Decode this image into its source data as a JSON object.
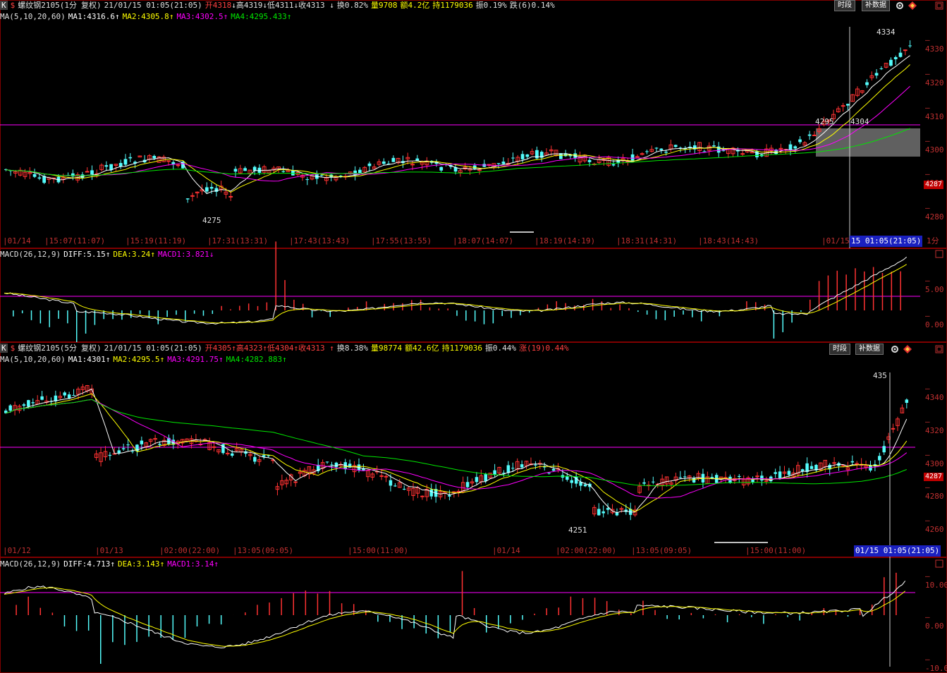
{
  "top": {
    "k_icon": "K",
    "dollar": "$",
    "name": "螺纹钢2105(1分",
    "fq": "复权)",
    "datetime": "21/01/15 01:05(21:05)",
    "open": "开4318",
    "high": "高4319",
    "low": "低4311",
    "close": "收4313",
    "turnover": "换0.82%",
    "volume": "量9708",
    "amount": "额4.2亿",
    "hold": "持1179036",
    "amp": "振0.19%",
    "change": "跌(6)0.14%",
    "ma_label": "MA(5,10,20,60)",
    "ma1": "MA1:4316.6",
    "ma2": "MA2:4305.8",
    "ma3": "MA3:4302.5",
    "ma4": "MA4:4295.433",
    "btn_time": "时段",
    "btn_data": "补数据",
    "y_ticks": [
      "4330",
      "4320",
      "4310",
      "4300",
      "4290",
      "4280"
    ],
    "price_tag": "4287",
    "hi_label": "4334",
    "lo_label": "4275",
    "mid_label1": "4295",
    "mid_label2": "4304",
    "time_axis": [
      "01/14",
      "15:07(11:07)",
      "15:19(11:19)",
      "17:31(13:31)",
      "17:43(13:43)",
      "17:55(13:55)",
      "18:07(14:07)",
      "18:19(14:19)",
      "18:31(14:31)",
      "18:43(14:43)",
      "01/15"
    ],
    "time_cursor": "15 01:05(21:05)",
    "period": "1分",
    "macd_label": "MACD(26,12,9)",
    "diff": "DIFF:5.15",
    "dea": "DEA:3.24",
    "macd": "MACD1:3.821",
    "macd_ticks": [
      "5.00",
      "0.00"
    ]
  },
  "bottom": {
    "k_icon": "K",
    "dollar": "$",
    "name": "螺纹钢2105(5分",
    "fq": "复权)",
    "datetime": "21/01/15 01:05(21:05)",
    "open": "开4305",
    "high": "高4323",
    "low": "低4304",
    "close": "收4313",
    "turnover": "换8.38%",
    "volume": "量98774",
    "amount": "额42.6亿",
    "hold": "持1179036",
    "amp": "振0.44%",
    "change": "涨(19)0.44%",
    "ma_label": "MA(5,10,20,60)",
    "ma1": "MA1:4301",
    "ma2": "MA2:4295.5",
    "ma3": "MA3:4291.75",
    "ma4": "MA4:4282.883",
    "btn_time": "时段",
    "btn_data": "补数据",
    "y_ticks": [
      "4340",
      "4320",
      "4300",
      "4280",
      "4260"
    ],
    "price_tag": "4287",
    "hi_label": "435",
    "lo_label": "4251",
    "time_axis": [
      "01/12",
      "01/13",
      "02:00(22:00)",
      "13:05(09:05)",
      "15:00(11:00)",
      "01/14",
      "02:00(22:00)",
      "13:05(09:05)",
      "15:00(11:00)"
    ],
    "time_cursor": "01/15 01:05(21:05)",
    "macd_label": "MACD(26,12,9)",
    "diff": "DIFF:4.713",
    "dea": "DEA:3.143",
    "macd": "MACD1:3.14",
    "macd_ticks": [
      "10.00",
      "0.00",
      "-10.00"
    ]
  },
  "colors": {
    "up": "#ff3232",
    "down": "#54fcfc",
    "ma1": "#ffffff",
    "ma2": "#ffff00",
    "ma3": "#ff00ff",
    "ma4": "#00e600",
    "axis": "#c03030",
    "hline": "#ff00ff"
  }
}
